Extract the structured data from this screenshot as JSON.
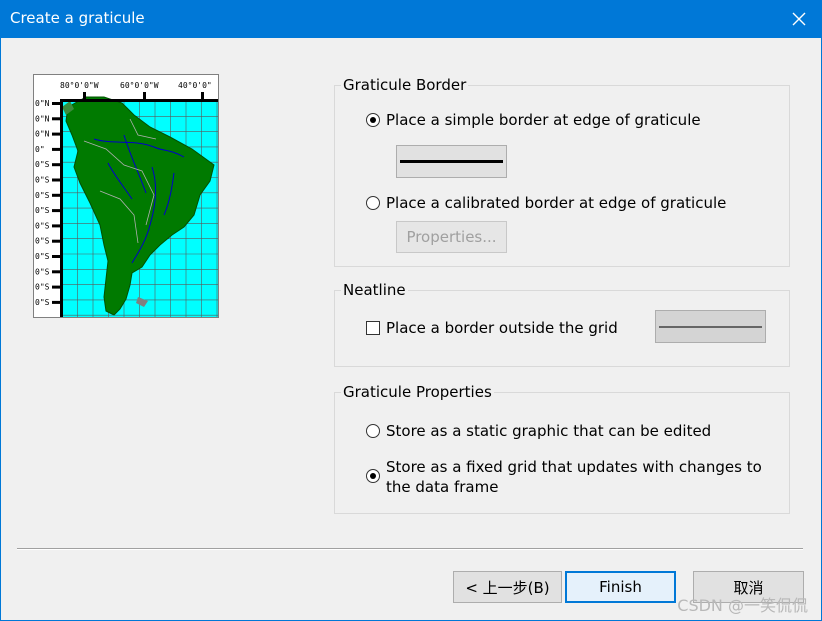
{
  "window": {
    "title": "Create a graticule",
    "close_icon": "close-icon"
  },
  "preview": {
    "top_ticks": [
      "80°0'0\"W",
      "60°0'0\"W",
      "40°0'0\""
    ],
    "left_ticks": [
      "0\"N",
      "0\"N",
      "0\"N",
      "0\"",
      "0\"S",
      "0\"S",
      "0\"S",
      "0\"S",
      "0\"S",
      "0\"S",
      "0\"S",
      "0\"S",
      "0\"S",
      "0\"S"
    ],
    "colors": {
      "ocean": "#00ffff",
      "land": "#007a00",
      "grid": "#5a5a5a",
      "rivers": "#0000c8",
      "borders": "#b0b0b0"
    }
  },
  "border_group": {
    "label": "Graticule Border",
    "simple_label": "Place a simple border at edge of graticule",
    "simple_checked": true,
    "calibrated_label": "Place a calibrated border at edge of graticule",
    "calibrated_checked": false,
    "properties_label": "Properties..."
  },
  "neatline_group": {
    "label": "Neatline",
    "checkbox_label": "Place a border outside the grid",
    "checked": false
  },
  "properties_group": {
    "label": "Graticule Properties",
    "static_label": "Store as a static graphic that can be edited",
    "static_checked": false,
    "fixed_label": "Store as a fixed grid that updates with changes to the data frame",
    "fixed_checked": true
  },
  "buttons": {
    "back": "< 上一步(B)",
    "finish": "Finish",
    "cancel": "取消"
  },
  "watermark": "CSDN @一笑侃侃"
}
